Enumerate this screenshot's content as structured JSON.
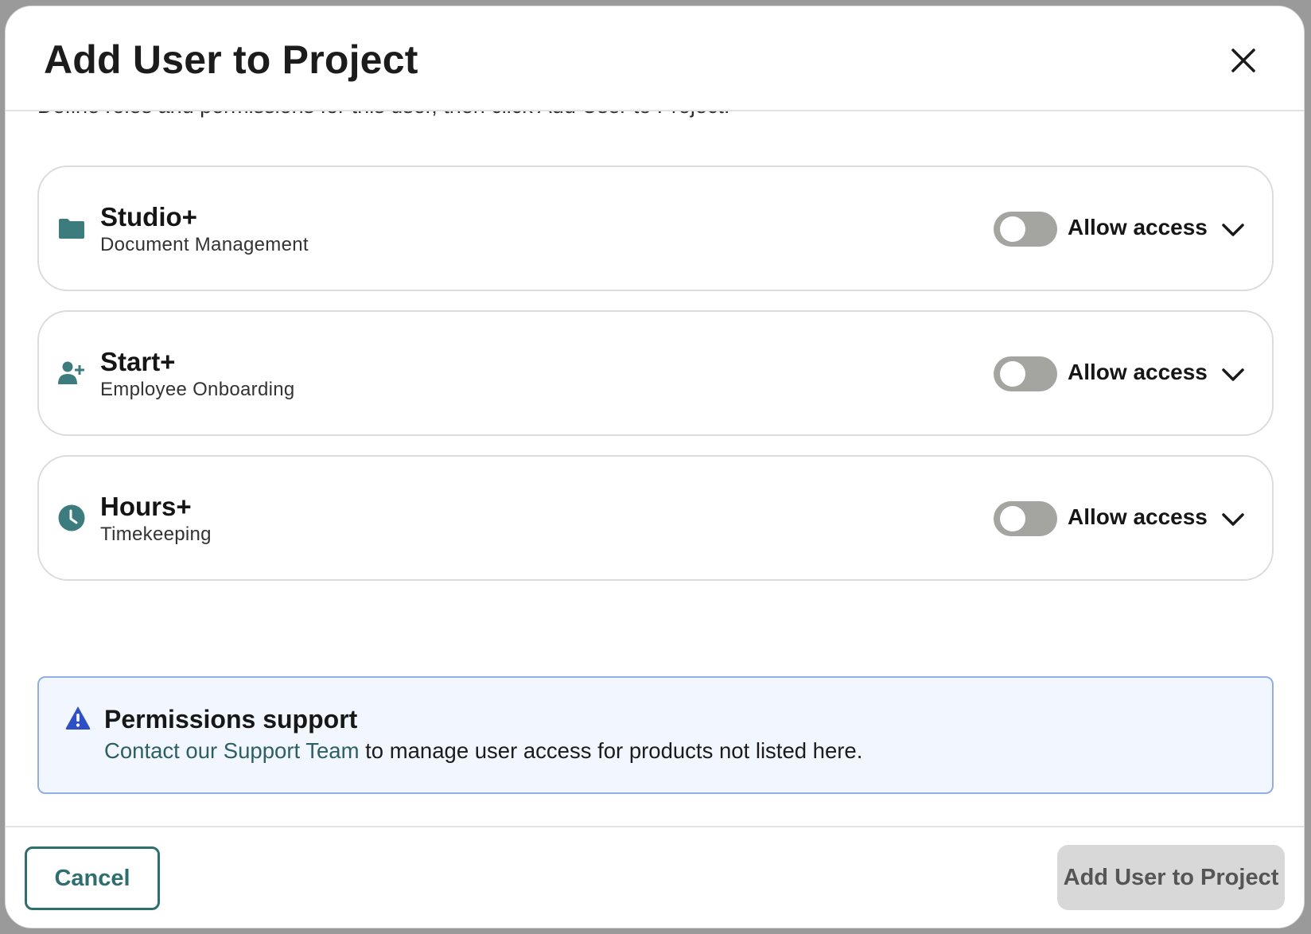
{
  "modal": {
    "title": "Add User to Project",
    "intro": "Define roles and permissions for this user, then click Add User to Project."
  },
  "products": [
    {
      "icon": "folder-icon",
      "title": "Studio+",
      "subtitle": "Document Management",
      "toggle_on": false,
      "toggle_label": "Allow access"
    },
    {
      "icon": "user-plus-icon",
      "title": "Start+",
      "subtitle": "Employee Onboarding",
      "toggle_on": false,
      "toggle_label": "Allow access"
    },
    {
      "icon": "clock-icon",
      "title": "Hours+",
      "subtitle": "Timekeeping",
      "toggle_on": false,
      "toggle_label": "Allow access"
    }
  ],
  "alert": {
    "icon": "warning-icon",
    "title": "Permissions support",
    "link_text": "Contact our Support Team",
    "text": " to manage user access for products not listed here."
  },
  "footer": {
    "cancel_label": "Cancel",
    "submit_label": "Add User to Project"
  },
  "colors": {
    "accent": "#2e6e70",
    "icon": "#3c7c7f",
    "toggle_off": "#a4a5a1",
    "alert_border": "#93aee4",
    "alert_bg": "#f2f6fe",
    "alert_icon": "#2f4fc4",
    "disabled_button": "#d8d8d8"
  }
}
